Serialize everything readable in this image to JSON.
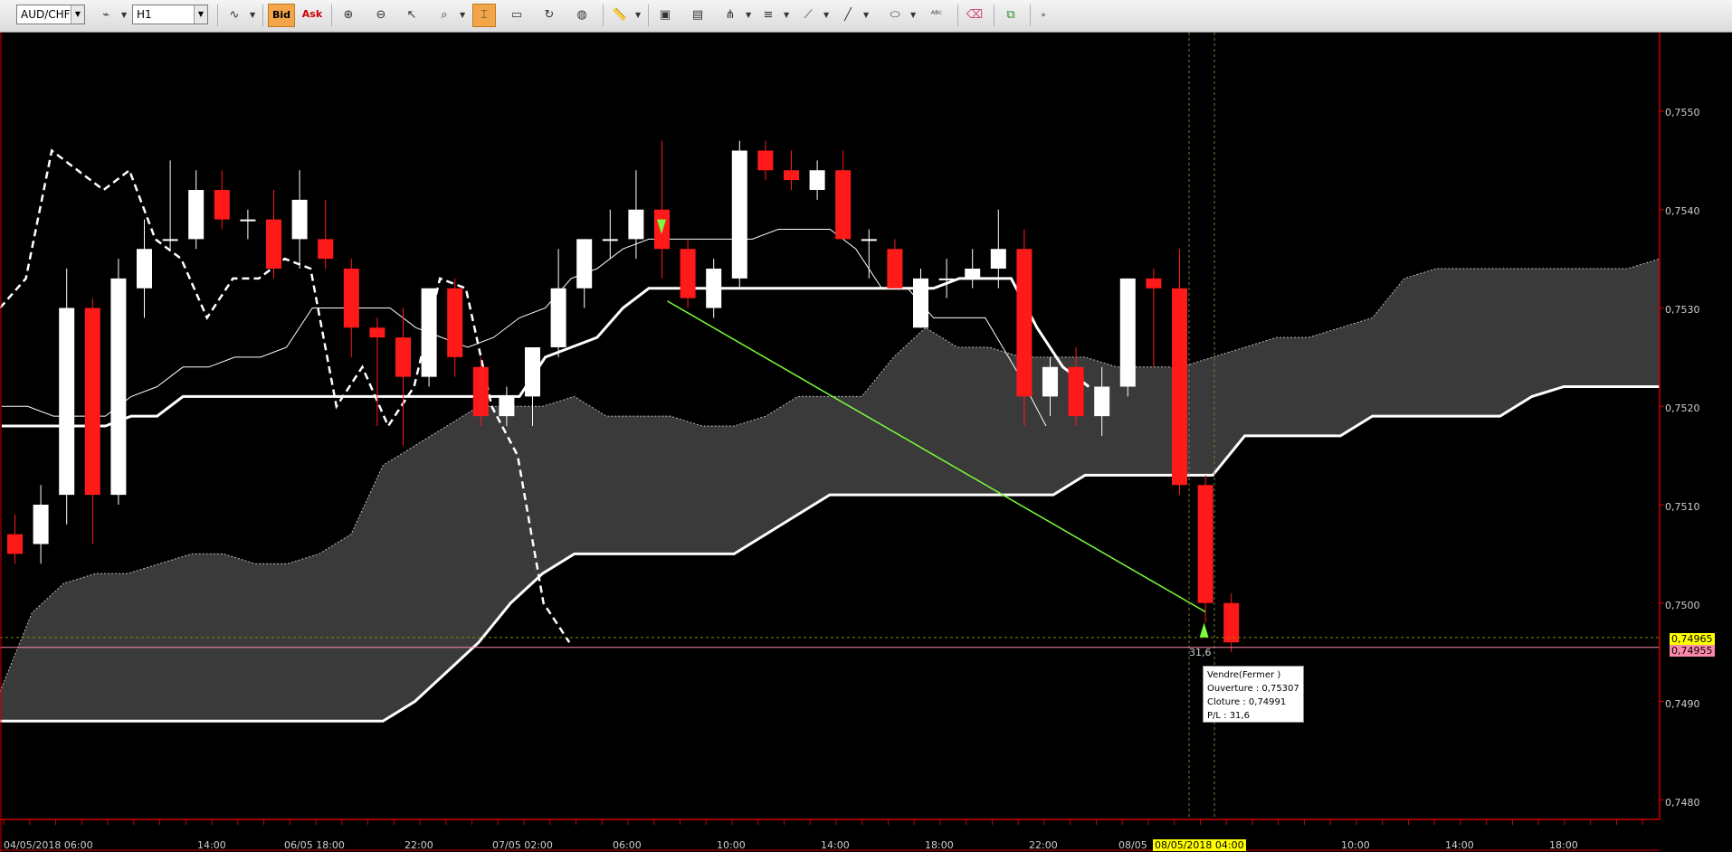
{
  "toolbar": {
    "symbol": "AUD/CHF",
    "timeframe": "H1",
    "bid_label": "Bid",
    "ask_label": "Ask"
  },
  "colors": {
    "background": "#000000",
    "bear_candle": "#ff1a1a",
    "bull_candle": "#ffffff",
    "cloud": "#3a3a3a",
    "trend_line": "#7cfc3a",
    "axis": "#cc0000",
    "current_price_flag": "#ffff00",
    "bid_price_flag": "#ff88aa"
  },
  "price_axis": {
    "ticks": [
      "0,7550",
      "0,7540",
      "0,7530",
      "0,7520",
      "0,7510",
      "0,7500",
      "0,7490",
      "0,7480"
    ],
    "flag_current": "0,74965",
    "flag_bid": "0,74955"
  },
  "time_axis": {
    "ticks": [
      "04/05/2018 06:00",
      "14:00",
      "06/05 18:00",
      "22:00",
      "07/05 02:00",
      "06:00",
      "10:00",
      "14:00",
      "18:00",
      "22:00",
      "08/05",
      "08/05/2018 04:00",
      "10:00",
      "14:00",
      "18:00"
    ],
    "highlight": "08/05/2018 04:00"
  },
  "trade": {
    "pl_marker": "31,6",
    "tooltip_title": "Vendre(Fermer )",
    "tooltip_open": "Ouverture : 0,75307",
    "tooltip_close": "Cloture : 0,74991",
    "tooltip_pl": "P/L : 31,6"
  },
  "chart_data": {
    "type": "candlestick",
    "symbol": "AUD/CHF",
    "interval": "H1",
    "ylim": [
      0.7478,
      0.7558
    ],
    "candles": [
      {
        "o": 0.7507,
        "h": 0.7509,
        "l": 0.7504,
        "c": 0.7505
      },
      {
        "o": 0.7506,
        "h": 0.7512,
        "l": 0.7504,
        "c": 0.751
      },
      {
        "o": 0.7511,
        "h": 0.7534,
        "l": 0.7508,
        "c": 0.753
      },
      {
        "o": 0.753,
        "h": 0.7531,
        "l": 0.7506,
        "c": 0.7511
      },
      {
        "o": 0.7511,
        "h": 0.7535,
        "l": 0.751,
        "c": 0.7533
      },
      {
        "o": 0.7532,
        "h": 0.7539,
        "l": 0.7529,
        "c": 0.7536
      },
      {
        "o": 0.7537,
        "h": 0.7545,
        "l": 0.7536,
        "c": 0.7537
      },
      {
        "o": 0.7537,
        "h": 0.7544,
        "l": 0.7536,
        "c": 0.7542
      },
      {
        "o": 0.7542,
        "h": 0.7544,
        "l": 0.7538,
        "c": 0.7539
      },
      {
        "o": 0.7539,
        "h": 0.754,
        "l": 0.7537,
        "c": 0.7539
      },
      {
        "o": 0.7539,
        "h": 0.7542,
        "l": 0.7533,
        "c": 0.7534
      },
      {
        "o": 0.7537,
        "h": 0.7544,
        "l": 0.7534,
        "c": 0.7541
      },
      {
        "o": 0.7537,
        "h": 0.7541,
        "l": 0.7534,
        "c": 0.7535
      },
      {
        "o": 0.7534,
        "h": 0.7535,
        "l": 0.7525,
        "c": 0.7528
      },
      {
        "o": 0.7528,
        "h": 0.7529,
        "l": 0.7518,
        "c": 0.7527
      },
      {
        "o": 0.7527,
        "h": 0.753,
        "l": 0.7516,
        "c": 0.7523
      },
      {
        "o": 0.7523,
        "h": 0.7532,
        "l": 0.7522,
        "c": 0.7532
      },
      {
        "o": 0.7532,
        "h": 0.7533,
        "l": 0.7523,
        "c": 0.7525
      },
      {
        "o": 0.7524,
        "h": 0.7525,
        "l": 0.7518,
        "c": 0.7519
      },
      {
        "o": 0.7519,
        "h": 0.7522,
        "l": 0.7518,
        "c": 0.7521
      },
      {
        "o": 0.7521,
        "h": 0.7526,
        "l": 0.7518,
        "c": 0.7526
      },
      {
        "o": 0.7526,
        "h": 0.7536,
        "l": 0.7525,
        "c": 0.7532
      },
      {
        "o": 0.7532,
        "h": 0.7537,
        "l": 0.753,
        "c": 0.7537
      },
      {
        "o": 0.7537,
        "h": 0.754,
        "l": 0.7535,
        "c": 0.7537
      },
      {
        "o": 0.7537,
        "h": 0.7544,
        "l": 0.7535,
        "c": 0.754
      },
      {
        "o": 0.754,
        "h": 0.7547,
        "l": 0.7533,
        "c": 0.7536
      },
      {
        "o": 0.7536,
        "h": 0.7537,
        "l": 0.753,
        "c": 0.7531
      },
      {
        "o": 0.753,
        "h": 0.7535,
        "l": 0.7529,
        "c": 0.7534
      },
      {
        "o": 0.7533,
        "h": 0.7547,
        "l": 0.7532,
        "c": 0.7546
      },
      {
        "o": 0.7546,
        "h": 0.7547,
        "l": 0.7543,
        "c": 0.7544
      },
      {
        "o": 0.7544,
        "h": 0.7546,
        "l": 0.7542,
        "c": 0.7543
      },
      {
        "o": 0.7542,
        "h": 0.7545,
        "l": 0.7541,
        "c": 0.7544
      },
      {
        "o": 0.7544,
        "h": 0.7546,
        "l": 0.7537,
        "c": 0.7537
      },
      {
        "o": 0.7537,
        "h": 0.7538,
        "l": 0.7533,
        "c": 0.7537
      },
      {
        "o": 0.7536,
        "h": 0.7537,
        "l": 0.7532,
        "c": 0.7532
      },
      {
        "o": 0.7528,
        "h": 0.7534,
        "l": 0.7528,
        "c": 0.7533
      },
      {
        "o": 0.7533,
        "h": 0.7535,
        "l": 0.7531,
        "c": 0.7533
      },
      {
        "o": 0.7533,
        "h": 0.7536,
        "l": 0.7532,
        "c": 0.7534
      },
      {
        "o": 0.7534,
        "h": 0.754,
        "l": 0.7532,
        "c": 0.7536
      },
      {
        "o": 0.7536,
        "h": 0.7538,
        "l": 0.7518,
        "c": 0.7521
      },
      {
        "o": 0.7521,
        "h": 0.7525,
        "l": 0.7519,
        "c": 0.7524
      },
      {
        "o": 0.7524,
        "h": 0.7526,
        "l": 0.7518,
        "c": 0.7519
      },
      {
        "o": 0.7519,
        "h": 0.7524,
        "l": 0.7517,
        "c": 0.7522
      },
      {
        "o": 0.7522,
        "h": 0.7533,
        "l": 0.7521,
        "c": 0.7533
      },
      {
        "o": 0.7533,
        "h": 0.7534,
        "l": 0.7524,
        "c": 0.7532
      },
      {
        "o": 0.7532,
        "h": 0.7536,
        "l": 0.7511,
        "c": 0.7512
      },
      {
        "o": 0.7512,
        "h": 0.7513,
        "l": 0.7498,
        "c": 0.75
      },
      {
        "o": 0.75,
        "h": 0.7501,
        "l": 0.7495,
        "c": 0.7496
      }
    ],
    "trade": {
      "side": "sell",
      "open": 0.75307,
      "close": 0.74991,
      "pl": 31.6
    }
  }
}
